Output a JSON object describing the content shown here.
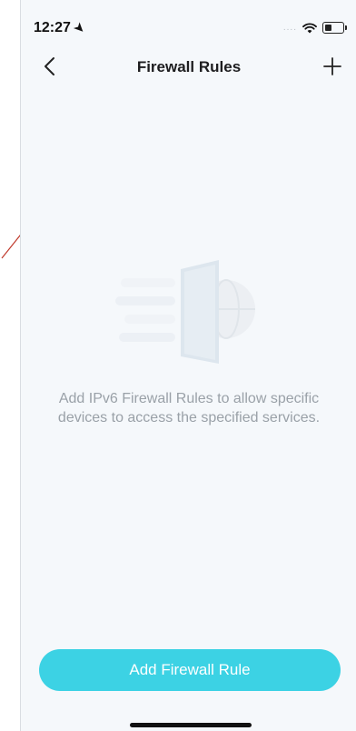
{
  "status_bar": {
    "time": "12:27",
    "signal_dots": "....",
    "icons": [
      "location-arrow-icon",
      "wifi-icon",
      "battery-icon"
    ]
  },
  "header": {
    "title": "Firewall Rules",
    "back_icon": "chevron-left-icon",
    "add_icon": "plus-icon"
  },
  "empty_state": {
    "illustration": "firewall-wall-globe-illustration",
    "message": "Add IPv6 Firewall Rules to allow specific devices to access the specified services."
  },
  "actions": {
    "add_rule_label": "Add Firewall Rule"
  },
  "colors": {
    "background": "#f5f8fb",
    "accent": "#3cd2e4",
    "muted_text": "#9aa1a8",
    "annotation": "#c0392b"
  }
}
